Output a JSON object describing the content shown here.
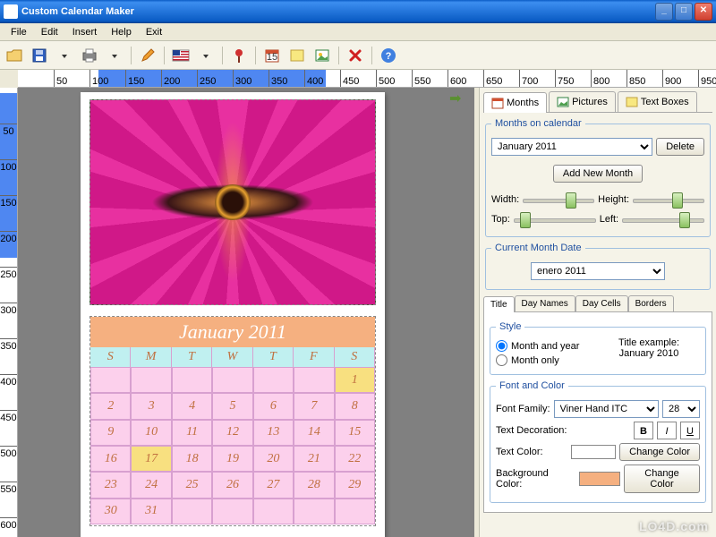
{
  "window": {
    "title": "Custom Calendar Maker"
  },
  "menu": {
    "file": "File",
    "edit": "Edit",
    "insert": "Insert",
    "help": "Help",
    "exit": "Exit"
  },
  "ruler_h": [
    50,
    100,
    150,
    200,
    250,
    300,
    350,
    400,
    450,
    500,
    550,
    600,
    650,
    700,
    750,
    800,
    850,
    900,
    950
  ],
  "ruler_v": [
    50,
    100,
    150,
    200,
    250,
    300,
    350,
    400,
    450,
    500,
    550,
    600
  ],
  "ruler_h_sel": [
    112,
    430
  ],
  "ruler_v_sel": [
    8,
    238
  ],
  "calendar": {
    "title": "January 2011",
    "days_short": [
      "S",
      "M",
      "T",
      "W",
      "T",
      "F",
      "S"
    ],
    "grid": [
      [
        "",
        "",
        "",
        "",
        "",
        "",
        "1"
      ],
      [
        "2",
        "3",
        "4",
        "5",
        "6",
        "7",
        "8"
      ],
      [
        "9",
        "10",
        "11",
        "12",
        "13",
        "14",
        "15"
      ],
      [
        "16",
        "17",
        "18",
        "19",
        "20",
        "21",
        "22"
      ],
      [
        "23",
        "24",
        "25",
        "26",
        "27",
        "28",
        "29"
      ],
      [
        "30",
        "31",
        "",
        "",
        "",
        "",
        ""
      ]
    ],
    "highlight": [
      "1",
      "17"
    ]
  },
  "panel": {
    "tabs": {
      "months": "Months",
      "pictures": "Pictures",
      "textboxes": "Text Boxes"
    },
    "months_on_calendar": "Months on calendar",
    "month_select": "January 2011",
    "delete": "Delete",
    "add_new_month": "Add New Month",
    "width": "Width:",
    "height": "Height:",
    "top": "Top:",
    "left": "Left:",
    "current_month_date": "Current Month Date",
    "current_month_value": "enero    2011",
    "subtabs": {
      "title": "Title",
      "daynames": "Day Names",
      "daycells": "Day Cells",
      "borders": "Borders"
    },
    "style": "Style",
    "month_and_year": "Month and year",
    "month_only": "Month only",
    "title_example": "Title example:",
    "title_example_val": "January 2010",
    "font_and_color": "Font and Color",
    "font_family": "Font Family:",
    "font_family_val": "Viner Hand ITC",
    "font_size": "28",
    "text_decoration": "Text Decoration:",
    "text_color": "Text Color:",
    "background_color": "Background Color:",
    "change_color": "Change Color",
    "text_color_val": "#ffffff",
    "bg_color_val": "#f5b080"
  },
  "watermark": "LO4D.com"
}
